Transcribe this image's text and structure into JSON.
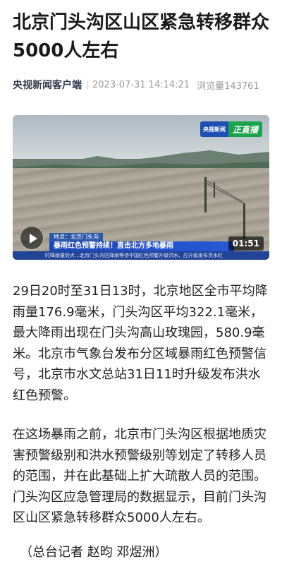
{
  "article": {
    "headline": "北京门头沟区山区紧急转移群众5000人左右",
    "source": "央视新闻客户端",
    "datetime": "2023-07-31 14:14:21",
    "views": "浏览量143761",
    "paragraphs": [
      "29日20时至31日13时，北京地区全市平均降雨量176.9毫米，门头沟区平均322.1毫米，最大降雨出现在门头沟高山玫瑰园，580.9毫米。北京市气象台发布分区域暴雨红色预警信号，北京市水文总站31日11时升级发布洪水红色预警。",
      "在这场暴雨之前，北京市门头沟区根据地质灾害预警级别和洪水预警级别等划定了转移人员的范围，并在此基础上扩大疏散人员的范围。门头沟区应急管理局的数据显示，目前门头沟区山区紧急转移群众5000人左右。"
    ],
    "byline": "（总台记者 赵昀 邓煜洲）"
  },
  "video": {
    "channel_badge": "央视新闻",
    "live_label": "正直播",
    "location_tag": "地点：北京门头沟",
    "banner_text": "暴雨红色预警持续！直击北方多地暴雨",
    "ticker_text": "时降雨量较大…北京门头沟区降雨等待中国红色预警升级洪水，应升级发布洪水红",
    "duration": "01:51"
  },
  "colors": {
    "source_text": "#2f3a4a",
    "meta_text": "#9a9a9a",
    "banner_blue": "#1c46b8",
    "live_green": "#1aa34a"
  },
  "icons": {
    "play": "play-icon"
  }
}
